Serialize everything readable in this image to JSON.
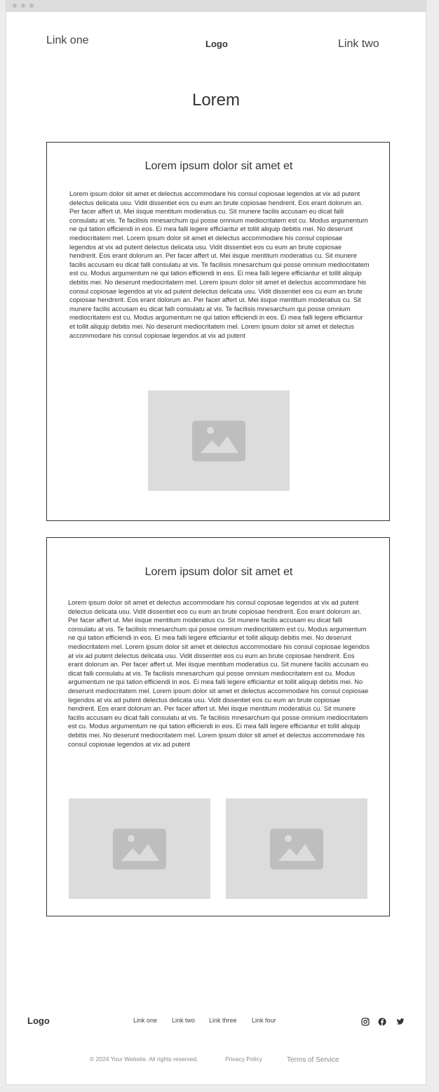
{
  "header": {
    "link_one": "Link one",
    "logo": "Logo",
    "link_two": "Link two"
  },
  "page_title": "Lorem",
  "cards": [
    {
      "title": "Lorem ipsum dolor sit amet et",
      "body": "Lorem ipsum dolor sit amet et delectus accommodare his consul copiosae legendos at vix ad putent delectus delicata usu. Vidit dissentiet eos cu eum an brute copiosae hendrerit. Eos erant dolorum an. Per facer affert ut. Mei iisque mentitum moderatius cu. Sit munere facilis accusam eu dicat falli consulatu at vis. Te facilisis mnesarchum qui posse omnium mediocritatem est cu. Modus argumentum ne qui tation efficiendi in eos. Ei mea falli legere efficiantur et tollit aliquip debitis mei. No deserunt mediocritatem mel. Lorem ipsum dolor sit amet et delectus accommodare his consul copiosae legendos at vix ad putent delectus delicata usu. Vidit dissentiet eos cu eum an brute copiosae hendrerit. Eos erant dolorum an. Per facer affert ut. Mei iisque mentitum moderatius cu. Sit munere facilis accusam eu dicat falli consulatu at vis. Te facilisis mnesarchum qui posse omnium mediocritatem est cu. Modus argumentum ne qui tation efficiendi in eos. Ei mea falli legere efficiantur et tollit aliquip debitis mei. No deserunt mediocritatem mel. Lorem ipsum dolor sit amet et delectus accommodare his consul copiosae legendos at vix ad putent delectus delicata usu. Vidit dissentiet eos cu eum an brute copiosae hendrerit. Eos erant dolorum an. Per facer affert ut. Mei iisque mentitum moderatius cu. Sit munere facilis accusam eu dicat falli consulatu at vis. Te facilisis mnesarchum qui posse omnium mediocritatem est cu. Modus argumentum ne qui tation efficiendi in eos. Ei mea falli legere efficiantur et tollit aliquip debitis mei. No deserunt mediocritatem mel. Lorem ipsum dolor sit amet et delectus accommodare his consul copiosae legendos at vix ad putent",
      "images": [
        "image-placeholder-icon"
      ]
    },
    {
      "title": "Lorem ipsum dolor sit amet et",
      "body": "Lorem ipsum dolor sit amet et delectus accommodare his consul copiosae legendos at vix ad putent delectus delicata usu. Vidit dissentiet eos cu eum an brute copiosae hendrerit. Eos erant dolorum an. Per facer affert ut. Mei iisque mentitum moderatius cu. Sit munere facilis accusam eu dicat falli consulatu at vis. Te facilisis mnesarchum qui posse omnium mediocritatem est cu. Modus argumentum ne qui tation efficiendi in eos. Ei mea falli legere efficiantur et tollit aliquip debitis mei. No deserunt mediocritatem mel. Lorem ipsum dolor sit amet et delectus accommodare his consul copiosae legendos at vix ad putent delectus delicata usu. Vidit dissentiet eos cu eum an brute copiosae hendrerit. Eos erant dolorum an. Per facer affert ut. Mei iisque mentitum moderatius cu. Sit munere facilis accusam eu dicat falli consulatu at vis. Te facilisis mnesarchum qui posse omnium mediocritatem est cu. Modus argumentum ne qui tation efficiendi in eos. Ei mea falli legere efficiantur et tollit aliquip debitis mei. No deserunt mediocritatem mel. Lorem ipsum dolor sit amet et delectus accommodare his consul copiosae legendos at vix ad putent delectus delicata usu. Vidit dissentiet eos cu eum an brute copiosae hendrerit. Eos erant dolorum an. Per facer affert ut. Mei iisque mentitum moderatius cu. Sit munere facilis accusam eu dicat falli consulatu at vis. Te facilisis mnesarchum qui posse omnium mediocritatem est cu. Modus argumentum ne qui tation efficiendi in eos. Ei mea falli legere efficiantur et tollit aliquip debitis mei. No deserunt mediocritatem mel. Lorem ipsum dolor sit amet et delectus accommodare his consul copiosae legendos at vix ad putent",
      "images": [
        "image-placeholder-icon",
        "image-placeholder-icon"
      ]
    }
  ],
  "footer": {
    "logo": "Logo",
    "links": [
      "Link one",
      "Link two",
      "Link three",
      "Link four"
    ],
    "social_icons": [
      "instagram-icon",
      "facebook-icon",
      "twitter-icon"
    ],
    "copyright": "© 2024 Your Website. All rights reserved.",
    "privacy": "Privacy Policy",
    "terms": "Terms of Service"
  },
  "colors": {
    "placeholder_bg": "#dcdcdc",
    "placeholder_icon": "#bebebe",
    "border": "#333333"
  }
}
